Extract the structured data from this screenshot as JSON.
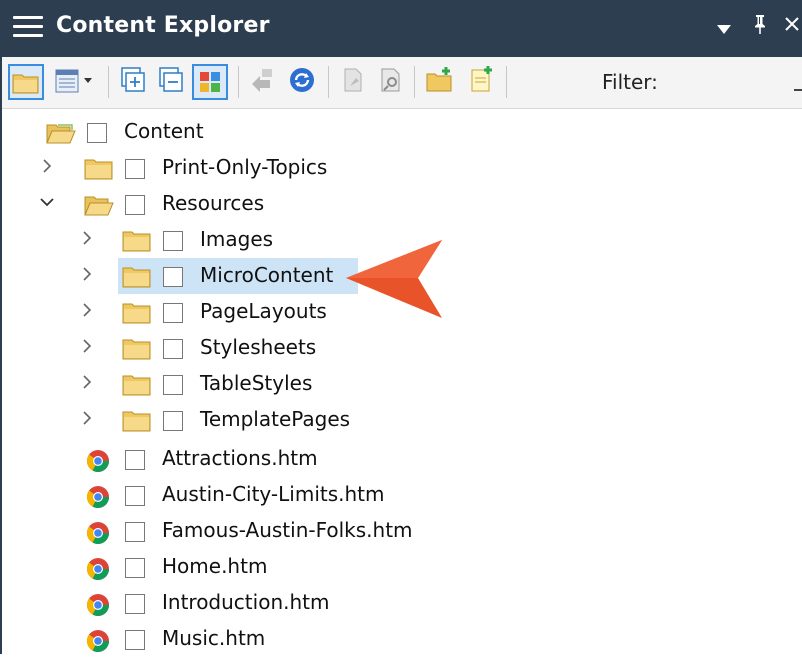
{
  "window": {
    "title": "Content Explorer",
    "dropdown_icon": "dropdown-arrow-icon",
    "pin_glyph": "Ԅ",
    "close_glyph": "×"
  },
  "toolbar": {
    "filter_label": "Filter:",
    "accent_color": "#3a8dde"
  },
  "tree": {
    "root": {
      "label": "Content",
      "type": "folder-open"
    },
    "items": [
      {
        "label": "Print-Only-Topics",
        "type": "folder",
        "state": "collapsed"
      },
      {
        "label": "Resources",
        "type": "folder-open",
        "state": "expanded"
      },
      {
        "label": "Images",
        "type": "folder",
        "state": "collapsed"
      },
      {
        "label": "MicroContent",
        "type": "folder",
        "state": "collapsed",
        "selected": true
      },
      {
        "label": "PageLayouts",
        "type": "folder",
        "state": "collapsed"
      },
      {
        "label": "Stylesheets",
        "type": "folder",
        "state": "collapsed"
      },
      {
        "label": "TableStyles",
        "type": "folder",
        "state": "collapsed"
      },
      {
        "label": "TemplatePages",
        "type": "folder",
        "state": "collapsed"
      },
      {
        "label": "Attractions.htm",
        "type": "chrome-file"
      },
      {
        "label": "Austin-City-Limits.htm",
        "type": "chrome-file"
      },
      {
        "label": "Famous-Austin-Folks.htm",
        "type": "chrome-file"
      },
      {
        "label": "Home.htm",
        "type": "chrome-file"
      },
      {
        "label": "Introduction.htm",
        "type": "chrome-file"
      },
      {
        "label": "Music.htm",
        "type": "chrome-file"
      }
    ]
  },
  "callout": {
    "color": "#e8532a"
  }
}
